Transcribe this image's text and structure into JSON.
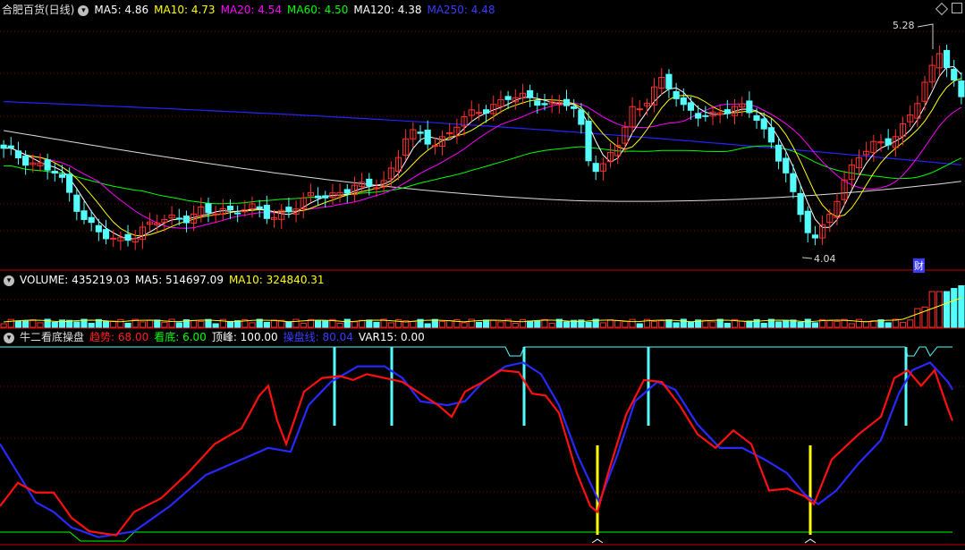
{
  "header_price": {
    "stock": "合肥百货(日线)",
    "items": [
      {
        "label": "MA5: 4.86",
        "color": "#ffffff"
      },
      {
        "label": "MA10: 4.73",
        "color": "#ffff00"
      },
      {
        "label": "MA20: 4.54",
        "color": "#ff00ff"
      },
      {
        "label": "MA60: 4.50",
        "color": "#00ff00"
      },
      {
        "label": "MA120: 4.38",
        "color": "#ffffff"
      },
      {
        "label": "MA250: 4.48",
        "color": "#3b3bff"
      }
    ]
  },
  "header_volume": {
    "items": [
      {
        "label": "VOLUME: 435219.03",
        "color": "#ffffff"
      },
      {
        "label": "MA5: 514697.09",
        "color": "#ffffff"
      },
      {
        "label": "MA10: 324840.31",
        "color": "#ffff00"
      }
    ]
  },
  "header_indicator": {
    "title": "牛二看底操盘",
    "items": [
      {
        "label": "趋势: 68.00",
        "color": "#ff2020"
      },
      {
        "label": "看底: 6.00",
        "color": "#00ff00"
      },
      {
        "label": "顶峰: 100.00",
        "color": "#ffffff"
      },
      {
        "label": "操盘线: 80.04",
        "color": "#3b3bff"
      },
      {
        "label": "VAR15: 0.00",
        "color": "#ffffff"
      }
    ]
  },
  "annotations": {
    "high": "5.28",
    "low": "4.04",
    "badge": "财"
  },
  "colors": {
    "up": "#ff3030",
    "down": "#54fcfc",
    "grid": "#8b0000",
    "ma5": "#ffffff",
    "ma10": "#ffff00",
    "ma20": "#ff00ff",
    "ma60": "#00ff00",
    "ma120": "#dddddd",
    "ma250": "#2424ff"
  },
  "chart_data": {
    "type": "candlestick",
    "price_range": [
      3.95,
      5.45
    ],
    "candles_seed": [
      4.62,
      4.6,
      4.58,
      4.55,
      4.52,
      4.48,
      4.4,
      4.3,
      4.2,
      4.12,
      4.08,
      4.05,
      4.1,
      4.12,
      4.15,
      4.18,
      4.2,
      4.22,
      4.22,
      4.24,
      4.23,
      4.25,
      4.26,
      4.28,
      4.26,
      4.24,
      4.2,
      4.25,
      4.28,
      4.3,
      4.33,
      4.35,
      4.36,
      4.38,
      4.4,
      4.38,
      4.42,
      4.45,
      4.55,
      4.7,
      4.72,
      4.7,
      4.68,
      4.72,
      4.78,
      4.82,
      4.88,
      4.9,
      4.92,
      4.95,
      4.94,
      4.96,
      4.95,
      4.9,
      4.92,
      4.9,
      4.8,
      4.55,
      4.5,
      4.6,
      4.7,
      4.88,
      4.92,
      5.0,
      5.05,
      4.98,
      4.9,
      4.88,
      4.85,
      4.82,
      4.86,
      4.9,
      4.92,
      4.85,
      4.7,
      4.6,
      4.5,
      4.3,
      4.15,
      4.04,
      4.2,
      4.35,
      4.5,
      4.6,
      4.62,
      4.66,
      4.7,
      4.75,
      4.85,
      4.95,
      5.1,
      5.28,
      5.1,
      4.95
    ]
  }
}
